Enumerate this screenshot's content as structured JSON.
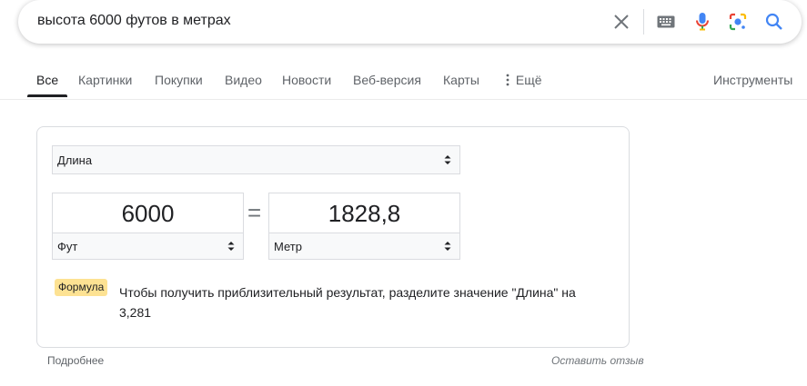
{
  "search": {
    "query": "высота 6000 футов в метрах"
  },
  "icons": {
    "clear": "close-icon",
    "keyboard": "keyboard-icon",
    "voice": "microphone-icon",
    "lens": "google-lens-icon",
    "search": "search-icon"
  },
  "colors": {
    "google_blue": "#4285f4",
    "google_red": "#ea4335",
    "google_yellow": "#fbbc04",
    "google_green": "#34a853",
    "formula_badge": "#fde293"
  },
  "tabs": [
    {
      "label": "Все",
      "active": true
    },
    {
      "label": "Картинки"
    },
    {
      "label": "Покупки"
    },
    {
      "label": "Видео"
    },
    {
      "label": "Новости"
    },
    {
      "label": "Веб-версия"
    },
    {
      "label": "Карты"
    },
    {
      "label": "Ещё"
    }
  ],
  "tools_label": "Инструменты",
  "converter": {
    "category": "Длина",
    "from_value": "6000",
    "from_unit": "Фут",
    "equals": "=",
    "to_value": "1828,8",
    "to_unit": "Метр",
    "formula_badge": "Формула",
    "formula_text": "Чтобы получить приблизительный результат, разделите значение \"Длина\" на 3,281"
  },
  "footer": {
    "more": "Подробнее",
    "feedback": "Оставить отзыв"
  }
}
